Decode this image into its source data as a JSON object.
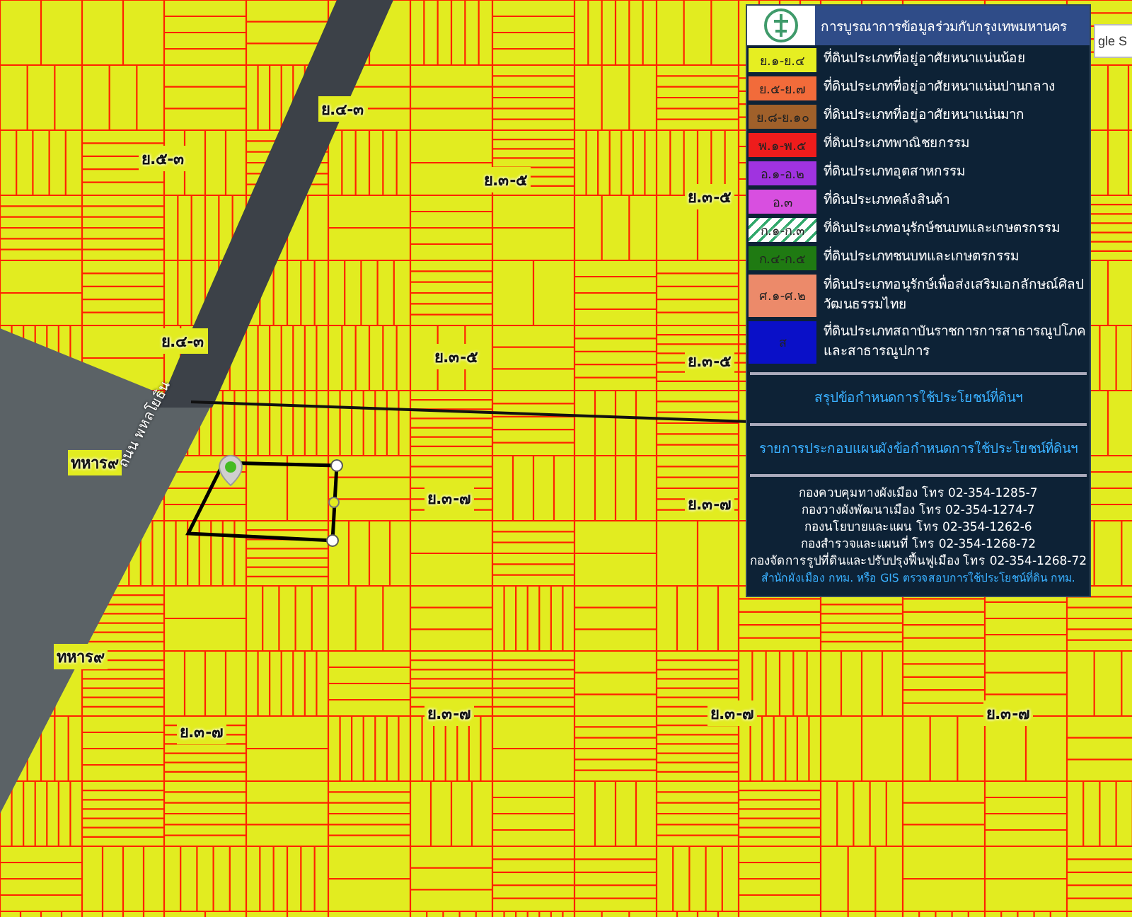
{
  "street_view_button": {
    "label": "gle S"
  },
  "map": {
    "zone_labels": [
      "ย.๔-๓",
      "ย.๕-๓",
      "ย.๓-๕",
      "ย.๓-๕",
      "ย.๔-๓",
      "ย.๓-๕",
      "ย.๓-๕",
      "ย.๓-๗",
      "ย.๓-๗",
      "ย.๓-๗",
      "ย.๓-๗",
      "ย.๓-๗",
      "ย.๓-๗"
    ],
    "place_labels": [
      "ทหาร๙",
      "ทหาร๙"
    ],
    "road_label": "ถนน พหลโยธิน"
  },
  "legend": {
    "title": "การบูรณาการข้อมูลร่วมกับกรุงเทพมหานคร",
    "items": [
      {
        "code": "ย.๑-ย.๔",
        "description": "ที่ดินประเภทที่อยู่อาศัยหนาแน่นน้อย",
        "color": "#e6ee22",
        "kind": "solid"
      },
      {
        "code": "ย.๕-ย.๗",
        "description": "ที่ดินประเภทที่อยู่อาศัยหนาแน่นปานกลาง",
        "color": "#f26b3a",
        "kind": "solid"
      },
      {
        "code": "ย.๘-ย.๑๐",
        "description": "ที่ดินประเภทที่อยู่อาศัยหนาแน่นมาก",
        "color": "#a0602a",
        "kind": "solid"
      },
      {
        "code": "พ.๑-พ.๕",
        "description": "ที่ดินประเภทพาณิชยกรรม",
        "color": "#ee1c1c",
        "kind": "solid"
      },
      {
        "code": "อ.๑-อ.๒",
        "description": "ที่ดินประเภทอุตสาหกรรม",
        "color": "#a033e0",
        "kind": "solid"
      },
      {
        "code": "อ.๓",
        "description": "ที่ดินประเภทคลังสินค้า",
        "color": "#d84fe0",
        "kind": "solid"
      },
      {
        "code": "ก.๑-ก.๓",
        "description": "ที่ดินประเภทอนุรักษ์ชนบทและเกษตรกรรม",
        "color": "#2fa86a",
        "kind": "hatched"
      },
      {
        "code": "ก.๔-ก.๕",
        "description": "ที่ดินประเภทชนบทและเกษตรกรรม",
        "color": "#1f7a12",
        "kind": "solid"
      },
      {
        "code": "ศ.๑-ศ.๒",
        "description": "ที่ดินประเภทอนุรักษ์เพื่อส่งเสริมเอกลักษณ์ศิลปวัฒนธรรมไทย",
        "color": "#ec8a6a",
        "kind": "solid"
      },
      {
        "code": "ส",
        "description": "ที่ดินประเภทสถาบันราชการการสาธารณูปโภคและสาธารณูปการ",
        "color": "#0a10c8",
        "kind": "solid"
      }
    ],
    "links": [
      "สรุปข้อกำหนดการใช้ประโยชน์ที่ดินฯ",
      "รายการประกอบแผนผังข้อกำหนดการใช้ประโยชน์ที่ดินฯ"
    ],
    "contacts": [
      "กองควบคุมทางผังเมือง โทร 02-354-1285-7",
      "กองวางผังพัฒนาเมือง โทร 02-354-1274-7",
      "กองนโยบายและแผน โทร 02-354-1262-6",
      "กองสำรวจและแผนที่ โทร 02-354-1268-72",
      "กองจัดการรูปที่ดินและปรับปรุงฟื้นฟูเมือง โทร 02-354-1268-72"
    ],
    "footer_link": "สำนักผังเมือง กทม. หรือ GIS ตรวจสอบการใช้ประโยชน์ที่ดิน กทม."
  }
}
